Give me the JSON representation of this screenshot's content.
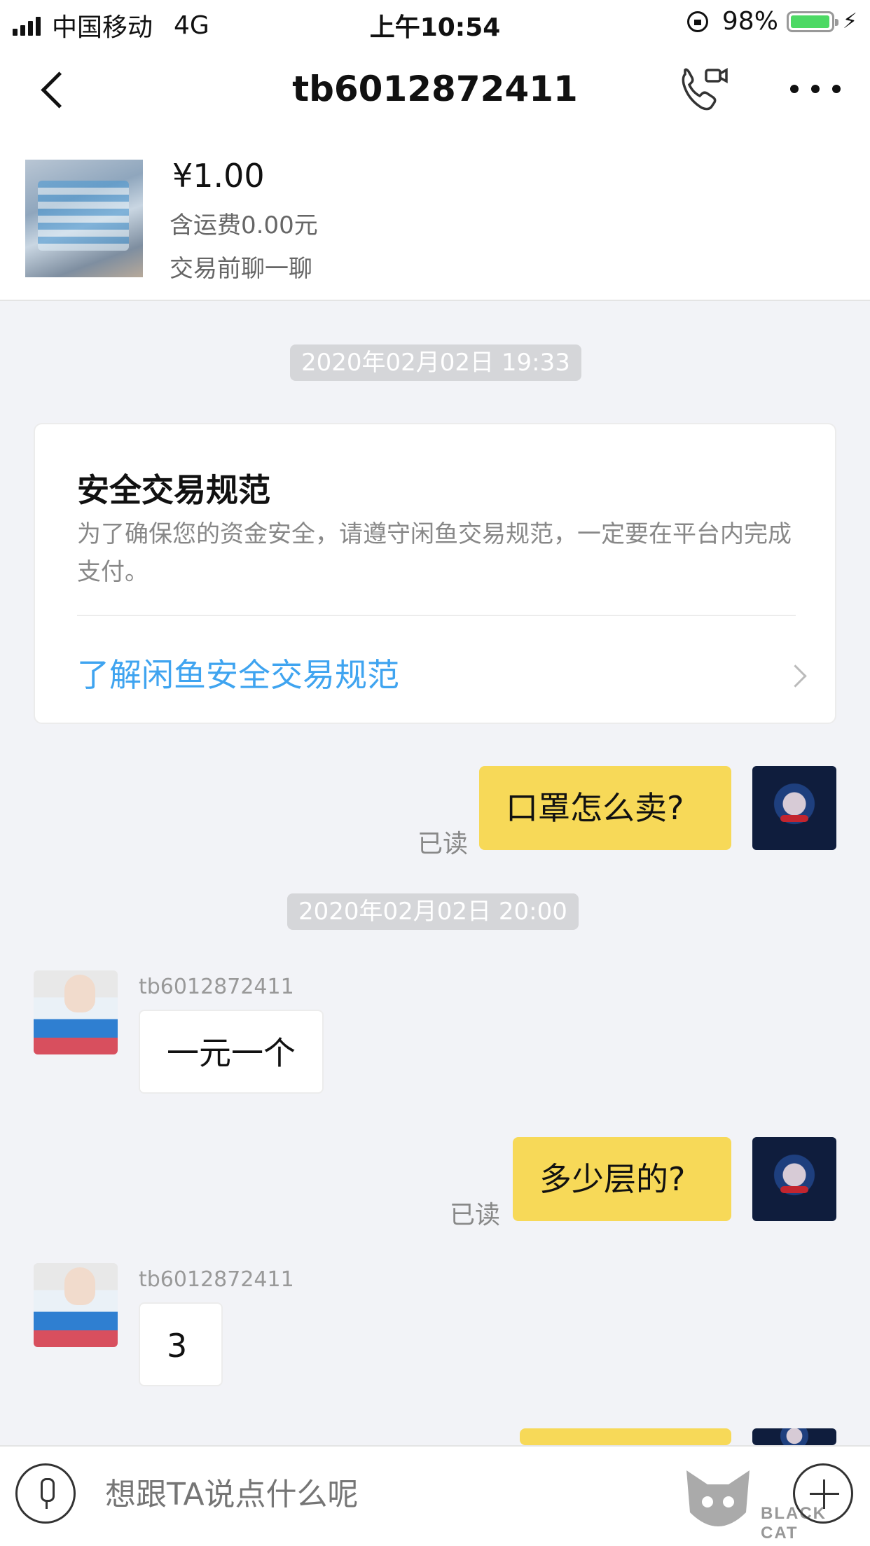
{
  "status_bar": {
    "carrier": "中国移动",
    "network": "4G",
    "time": "上午10:54",
    "battery": "98%",
    "battery_level": 0.98
  },
  "nav": {
    "title": "tb6012872411"
  },
  "product": {
    "price": "¥1.00",
    "shipping": "含运费0.00元",
    "note": "交易前聊一聊"
  },
  "timestamps": [
    "2020年02月02日 19:33",
    "2020年02月02日 20:00"
  ],
  "safety_card": {
    "title": "安全交易规范",
    "description": "为了确保您的资金安全，请遵守闲鱼交易规范，一定要在平台内完成支付。",
    "link": "了解闲鱼安全交易规范"
  },
  "messages": [
    {
      "from": "me",
      "text": "口罩怎么卖?",
      "read": "已读"
    },
    {
      "from": "seller",
      "sender": "tb6012872411",
      "text": "一元一个"
    },
    {
      "from": "me",
      "text": "多少层的?",
      "read": "已读"
    },
    {
      "from": "seller",
      "sender": "tb6012872411",
      "text": "3"
    }
  ],
  "input": {
    "placeholder": "想跟TA说点什么呢"
  },
  "watermark": {
    "text": "BLACK CAT"
  },
  "colors": {
    "accent_link": "#3fa4f0",
    "my_bubble": "#f7d958",
    "chat_background": "#f2f3f7"
  }
}
